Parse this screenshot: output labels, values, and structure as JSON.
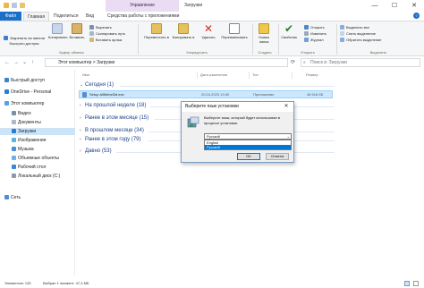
{
  "titlebar": {
    "context_group": "Управление",
    "title": "Загрузки",
    "minimize": "—",
    "maximize": "☐",
    "close": "✕"
  },
  "tabs": [
    {
      "label": "Файл"
    },
    {
      "label": "Главная"
    },
    {
      "label": "Поделиться"
    },
    {
      "label": "Вид"
    },
    {
      "label": "Средства работы с приложениями"
    }
  ],
  "ribbon": {
    "pin_label": "Закрепить на панели быстрого доступа",
    "copy_label": "Копировать",
    "paste_label": "Вставить",
    "cut_label": "Вырезать",
    "copy_path_label": "Скопировать путь",
    "paste_shortcut_label": "Вставить ярлык",
    "move_to_label": "Переместить в",
    "copy_to_label": "Копировать в",
    "delete_label": "Удалить",
    "rename_label": "Переименовать",
    "new_folder_label": "Новая папка",
    "properties_label": "Свойства",
    "open_label": "Открыть",
    "edit_label": "Изменить",
    "journal_label": "Журнал",
    "select_all_label": "Выделить все",
    "select_none_label": "Снять выделение",
    "invert_selection_label": "Обратить выделение",
    "group_clipboard": "Буфер обмена",
    "group_organize": "Упорядочить",
    "group_create": "Создать",
    "group_open": "Открыть",
    "group_select": "Выделить"
  },
  "address": {
    "path": "Этот компьютер > Загрузки",
    "search_placeholder": "Поиск в: Загрузки"
  },
  "nav": [
    {
      "label": "Быстрый доступ"
    },
    {
      "label": "OneDrive - Personal"
    },
    {
      "label": "Этот компьютер"
    },
    {
      "label": "Видео"
    },
    {
      "label": "Документы"
    },
    {
      "label": "Загрузки"
    },
    {
      "label": "Изображения"
    },
    {
      "label": "Музыка"
    },
    {
      "label": "Объемные объекты"
    },
    {
      "label": "Рабочий стол"
    },
    {
      "label": "Локальный диск (C:)"
    },
    {
      "label": "Сеть"
    }
  ],
  "columns": {
    "name": "Имя",
    "date": "Дата изменения",
    "type": "Тип",
    "size": "Размер"
  },
  "groups": {
    "today": "Сегодня (1)",
    "last_week": "На прошлой неделе (18)",
    "earlier_month": "Ранее в этом месяце (15)",
    "last_month": "В прошлом месяце (34)",
    "earlier_year": "Ранее в этом году (79)",
    "long_ago": "Давно (53)"
  },
  "file": {
    "name": "Setup AllMebel3d.exe",
    "date": "20.04.2023 13:00",
    "type": "Приложение",
    "size": "48 518 КБ"
  },
  "status": {
    "items": "Элементов: 133",
    "selected": "Выбран 1 элемент: 47,3 МБ"
  },
  "dialog": {
    "title": "Выберите язык установки",
    "close": "✕",
    "message": "Выберите язык, который будет использован в процессе установки.",
    "selected": "Русский",
    "options": [
      "English",
      "Русский"
    ],
    "ok": "OK",
    "cancel": "Отмена"
  },
  "colors": {
    "accent": "#1a6fc9",
    "selection": "#cce8ff",
    "group_header": "#1e3f8a",
    "context_tab": "#eadcf2"
  }
}
